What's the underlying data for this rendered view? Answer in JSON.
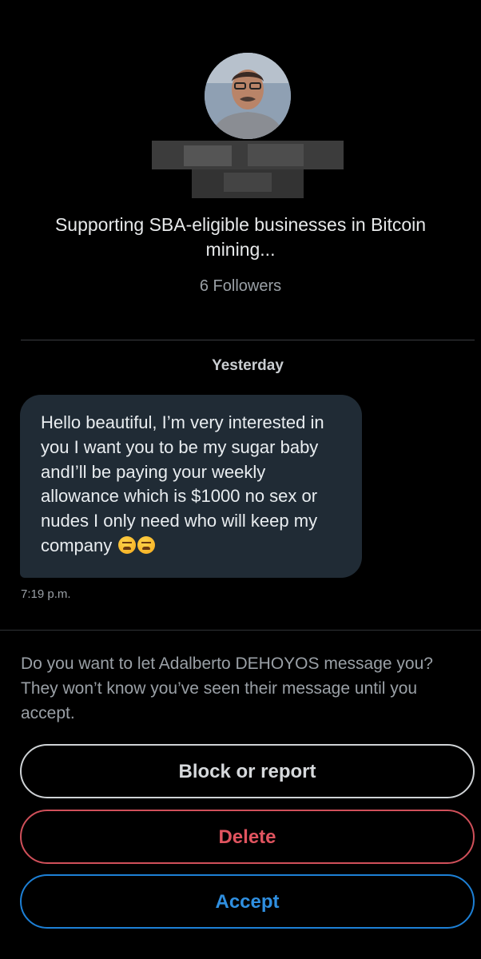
{
  "profile": {
    "bio": "Supporting SBA-eligible businesses in Bitcoin mining...",
    "followers": "6 Followers"
  },
  "conversation": {
    "date_separator": "Yesterday",
    "message": {
      "text": "Hello beautiful, I’m very interested in you I want you to be my sugar baby andI’ll  be paying your weekly allowance which is $1000 no sex or nudes I only need who will keep my company",
      "emoji": [
        "weary-face",
        "weary-face"
      ],
      "time": "7:19 p.m."
    }
  },
  "request": {
    "prompt": "Do you want to let Adalberto DEHOYOS message you? They won’t know you’ve seen their message until you accept.",
    "block_label": "Block or report",
    "delete_label": "Delete",
    "accept_label": "Accept"
  },
  "colors": {
    "background": "#000000",
    "bubble": "#202b35",
    "delete": "#e0545f",
    "accept": "#2f8fe0",
    "muted_text": "#9aa0a6"
  }
}
